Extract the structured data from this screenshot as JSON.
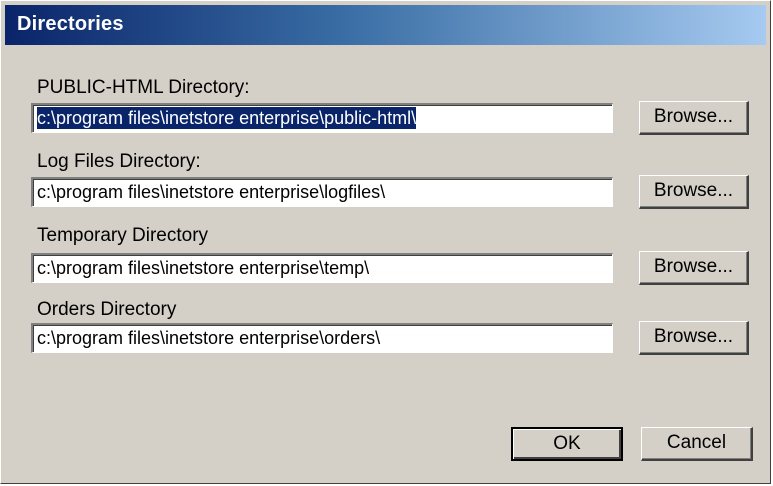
{
  "title": "Directories",
  "fields": [
    {
      "label": "PUBLIC-HTML Directory:",
      "value": "c:\\program files\\inetstore enterprise\\public-html\\",
      "selected": true,
      "browse_label": "Browse..."
    },
    {
      "label": "Log Files Directory:",
      "value": "c:\\program files\\inetstore enterprise\\logfiles\\",
      "selected": false,
      "browse_label": "Browse..."
    },
    {
      "label": "Temporary Directory",
      "value": "c:\\program files\\inetstore enterprise\\temp\\",
      "selected": false,
      "browse_label": "Browse..."
    },
    {
      "label": "Orders Directory",
      "value": "c:\\program files\\inetstore enterprise\\orders\\",
      "selected": false,
      "browse_label": "Browse..."
    }
  ],
  "buttons": {
    "ok": "OK",
    "cancel": "Cancel"
  },
  "colors": {
    "face": "#d4d0c8",
    "title_start": "#0a246a",
    "title_end": "#a6caf0",
    "selection": "#0a246a"
  }
}
